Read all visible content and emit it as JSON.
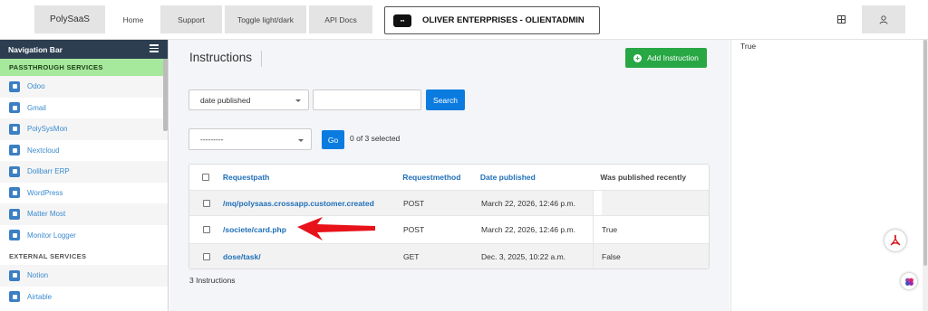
{
  "topbar": {
    "brand": "PolySaaS",
    "nav": [
      "Home",
      "Support",
      "Toggle light/dark",
      "API Docs"
    ],
    "org_name": "OLIVER ENTERPRISES - OLIENTADMIN",
    "grid_icon": "grid-icon",
    "user_icon": "user-icon"
  },
  "sidebar": {
    "title": "Navigation Bar",
    "section1": "PASSTHROUGH SERVICES",
    "passthrough": [
      {
        "label": "Odoo",
        "icon": "odoo-icon"
      },
      {
        "label": "Gmail",
        "icon": "gmail-icon"
      },
      {
        "label": "PolySysMon",
        "icon": "polysysmon-icon"
      },
      {
        "label": "Nextcloud",
        "icon": "nextcloud-icon"
      },
      {
        "label": "Dolibarr ERP",
        "icon": "dolibarr-icon"
      },
      {
        "label": "WordPress",
        "icon": "wordpress-icon"
      },
      {
        "label": "Matter Most",
        "icon": "mattermost-icon"
      },
      {
        "label": "Monitor Logger",
        "icon": "monitor-logger-icon"
      }
    ],
    "section2": "EXTERNAL SERVICES",
    "external": [
      {
        "label": "Notion",
        "icon": "notion-icon"
      },
      {
        "label": "Airtable",
        "icon": "airtable-icon"
      }
    ]
  },
  "main": {
    "title": "Instructions",
    "add_button": "Add Instruction",
    "filter_select": "date published",
    "search_value": "",
    "search_button": "Search",
    "action_select": "---------",
    "go_button": "Go",
    "selected_count": "0 of 3 selected",
    "table": {
      "headers": [
        "Requestpath",
        "Requestmethod",
        "Date published",
        "Was published recently"
      ],
      "rows": [
        {
          "path": "/mq/polysaas.crossapp.customer.created",
          "method": "POST",
          "date": "March 22, 2026, 12:46 p.m.",
          "recent": ""
        },
        {
          "path": "/societe/card.php",
          "method": "POST",
          "date": "March 22, 2026, 12:46 p.m.",
          "recent": "True"
        },
        {
          "path": "dose/task/",
          "method": "GET",
          "date": "Dec. 3, 2025, 10:22 a.m.",
          "recent": "False"
        }
      ]
    },
    "footer_count": "3 Instructions"
  },
  "right_panel": {
    "text": "True"
  },
  "colors": {
    "accent_blue": "#0b7be0",
    "add_green": "#28a745",
    "sidebar_header": "#2c3e50",
    "passthrough_bg": "#a6e89c",
    "arrow_red": "#e8121a"
  }
}
